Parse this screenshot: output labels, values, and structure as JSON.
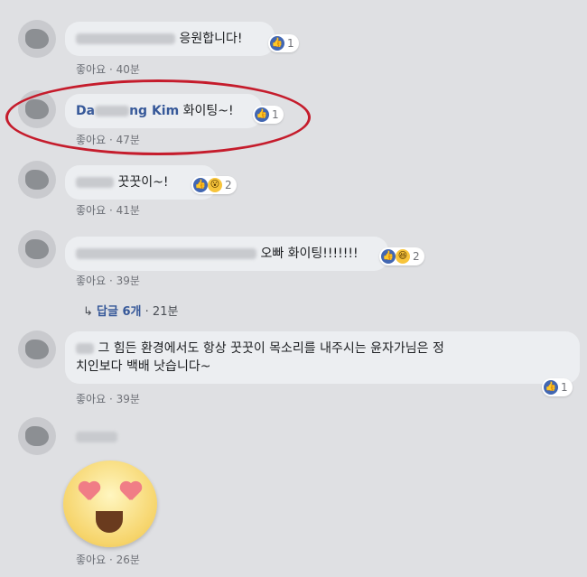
{
  "comments": [
    {
      "id": "c1",
      "blurred_prefix": "ilill",
      "text": "응원합니다!",
      "reaction_count": "1",
      "like_label": "좋아요",
      "time": "40분"
    },
    {
      "id": "c2",
      "name_prefix": "Da",
      "name_suffix": "ng Kim",
      "text": "화이팅~!",
      "reaction_count": "1",
      "like_label": "좋아요",
      "time": "47분"
    },
    {
      "id": "c3",
      "blurred_prefix": "ㅎㅇㄴ",
      "text": "꿋꿋이~!",
      "reaction_count": "2",
      "like_label": "좋아요",
      "time": "41분"
    },
    {
      "id": "c4",
      "text": "오빠 화이팅!!!!!!!",
      "reaction_count": "2",
      "like_label": "좋아요",
      "time": "39분",
      "reply_label": "답글 6개",
      "reply_time": "21분"
    },
    {
      "id": "c5",
      "blurred_prefix": "그",
      "text_line1": "힘든 환경에서도 항상 꿋꿋이 목소리를 내주시는 윤자가님은 정",
      "text_line2": "치인보다 백배 낫습니다~",
      "reaction_count": "1",
      "like_label": "좋아요",
      "time": "39분"
    },
    {
      "id": "c6",
      "like_label": "좋아요",
      "time": "26분"
    }
  ],
  "separator": "·",
  "reply_arrow": "↳",
  "colors": {
    "highlight": "#c51c2c",
    "like_blue": "#4267b2",
    "name_link": "#365899"
  }
}
